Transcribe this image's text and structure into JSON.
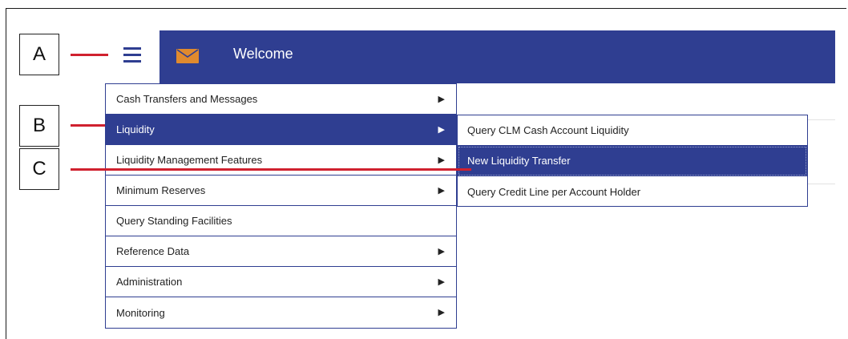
{
  "callouts": [
    {
      "label": "A"
    },
    {
      "label": "B"
    },
    {
      "label": "C"
    }
  ],
  "header": {
    "title": "Welcome",
    "icons": {
      "menu": "hamburger-icon",
      "mail": "envelope-icon"
    },
    "background_color": "#2f3e91",
    "mail_icon_color": "#e08a2e"
  },
  "menu": {
    "items": [
      {
        "label": "Cash Transfers and Messages",
        "has_submenu": true
      },
      {
        "label": "Liquidity",
        "has_submenu": true,
        "active": true
      },
      {
        "label": "Liquidity Management Features",
        "has_submenu": true
      },
      {
        "label": "Minimum Reserves",
        "has_submenu": true
      },
      {
        "label": "Query Standing Facilities",
        "has_submenu": false
      },
      {
        "label": "Reference Data",
        "has_submenu": true
      },
      {
        "label": "Administration",
        "has_submenu": true
      },
      {
        "label": "Monitoring",
        "has_submenu": true
      }
    ],
    "arrow_glyph": "▶"
  },
  "submenu": {
    "items": [
      {
        "label": "Query CLM Cash Account Liquidity"
      },
      {
        "label": "New Liquidity Transfer",
        "active": true
      },
      {
        "label": "Query Credit Line per Account Holder"
      }
    ]
  },
  "colors": {
    "accent": "#2f3e91",
    "callout_line": "#d0212f"
  }
}
